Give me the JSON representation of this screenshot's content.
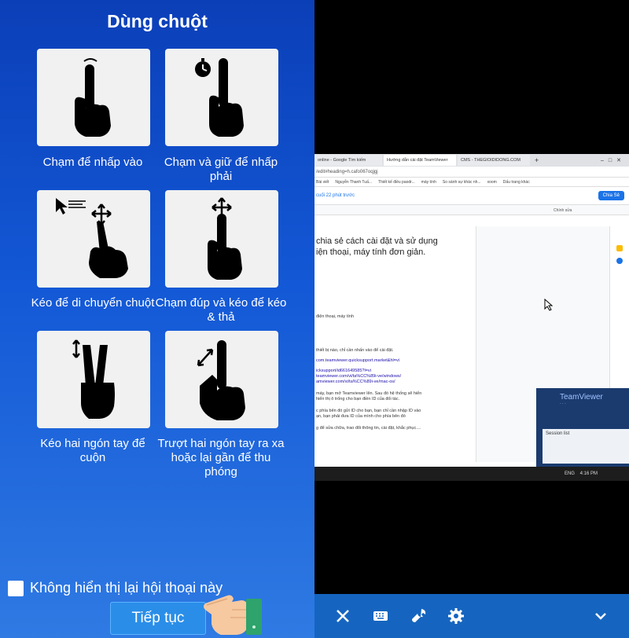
{
  "left_panel": {
    "title": "Dùng chuột",
    "gestures": [
      {
        "label": "Chạm để nhấp vào",
        "icon": "tap-icon"
      },
      {
        "label": "Chạm và giữ để nhấp phải",
        "icon": "tap-hold-icon"
      },
      {
        "label": "Kéo để di chuyển chuột",
        "icon": "drag-move-icon"
      },
      {
        "label": "Chạm đúp và kéo để kéo & thả",
        "icon": "double-tap-drag-icon"
      },
      {
        "label": "Kéo hai ngón tay để cuộn",
        "icon": "two-finger-scroll-icon"
      },
      {
        "label": "Trượt hai ngón tay ra xa hoặc lại gần để thu phóng",
        "icon": "pinch-zoom-icon"
      }
    ],
    "dont_show_label": "Không hiển thị lại hội thoại này",
    "continue_label": "Tiếp tục"
  },
  "remote": {
    "tabs": [
      "online - Google Tìm kiếm",
      "Hướng dẫn cài đặt TeamViewer",
      "CMS - THEGIOIDIDONG.COM"
    ],
    "url": "/edit#heading=h.cafo067oqjgj",
    "bookmarks": [
      "Bài viết",
      "Nguyễn Thanh Tuấ...",
      "Thiết kế điều paodr...",
      "máy tính",
      "So sánh sự khác nh...",
      "xoom",
      "Dấu trang khác"
    ],
    "doc_status": "cuối 22 phút trước",
    "share_label": "Chia Sẻ",
    "edit_mode": "Chính sửa",
    "body_large": [
      "chia sẻ cách cài đặt và sử dụng",
      "iện thoại, máy tính đơn giản."
    ],
    "body_small": [
      "điện thoại, máy tính",
      "thiết bị nào, chỉ cần nhấn vào để cài đặt.",
      "com.teamviewer.quicksupport.market&hl=vi",
      "icksupport/id661649585?l=vi",
      "teamviewer.com/vi/ta%CC%89i-ve/windows/",
      "amviewer.com/vi/ta%CC%89i-ve/mac-os/",
      "máy, bạn mở Teamviewer lên. Sau đó hệ thống sẽ hiển",
      "hiển thị ô trống cho bạn điền ID của đối tác.",
      "c phía bên đó gửi ID cho bạn, bạn chỉ cần nhập ID vào",
      "ạn, bạn phải đưa ID của mình cho phía bên đó",
      "g để sửa chữa, trao đổi thông tin, cài đặt, khắc phục...."
    ],
    "teamviewer_name": "TeamViewer",
    "session_list": "Session list",
    "taskbar_lang": "ENG",
    "taskbar_time": "4:16 PM"
  },
  "bottom_toolbar": [
    "close-icon",
    "keyboard-icon",
    "wrench-icon",
    "gear-icon",
    "chevron-down-icon"
  ],
  "colors": {
    "panel_top": "#0b3fb8",
    "panel_bottom": "#2f7ae3",
    "button": "#2a8ee8",
    "toolbar": "#1565c0"
  }
}
